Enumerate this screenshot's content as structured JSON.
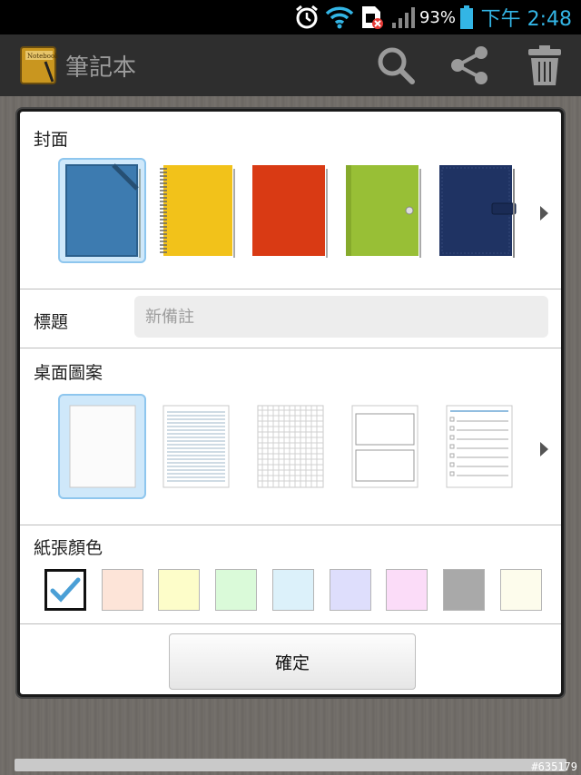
{
  "status_bar": {
    "battery_percent": "93%",
    "time": "下午 2:48"
  },
  "action_bar": {
    "app_title": "筆記本",
    "app_icon_label": "Notebook",
    "icons": [
      "search-icon",
      "share-icon",
      "trash-icon"
    ]
  },
  "dialog": {
    "cover_label": "封面",
    "covers": [
      {
        "name": "blue",
        "color": "#3d7bb0",
        "selected": true
      },
      {
        "name": "yellow-spiral",
        "color": "#f2c21a",
        "selected": false
      },
      {
        "name": "red",
        "color": "#d93a14",
        "selected": false
      },
      {
        "name": "green",
        "color": "#98bf36",
        "selected": false
      },
      {
        "name": "navy",
        "color": "#1f3363",
        "selected": false
      }
    ],
    "title_label": "標題",
    "title_placeholder": "新備註",
    "pattern_label": "桌面圖案",
    "patterns": [
      {
        "name": "blank",
        "selected": true
      },
      {
        "name": "lined",
        "selected": false
      },
      {
        "name": "grid",
        "selected": false
      },
      {
        "name": "two-boxes",
        "selected": false
      },
      {
        "name": "checklist",
        "selected": false
      }
    ],
    "paper_color_label": "紙張顏色",
    "paper_colors": [
      "#ffffff",
      "#fde4d8",
      "#fdfdc9",
      "#dafad9",
      "#dcf1fa",
      "#dedefc",
      "#fbdcf8",
      "#a9a9a9",
      "#fdfcec"
    ],
    "selected_paper_color_index": 0,
    "confirm_label": "確定"
  },
  "watermark": "#635179"
}
